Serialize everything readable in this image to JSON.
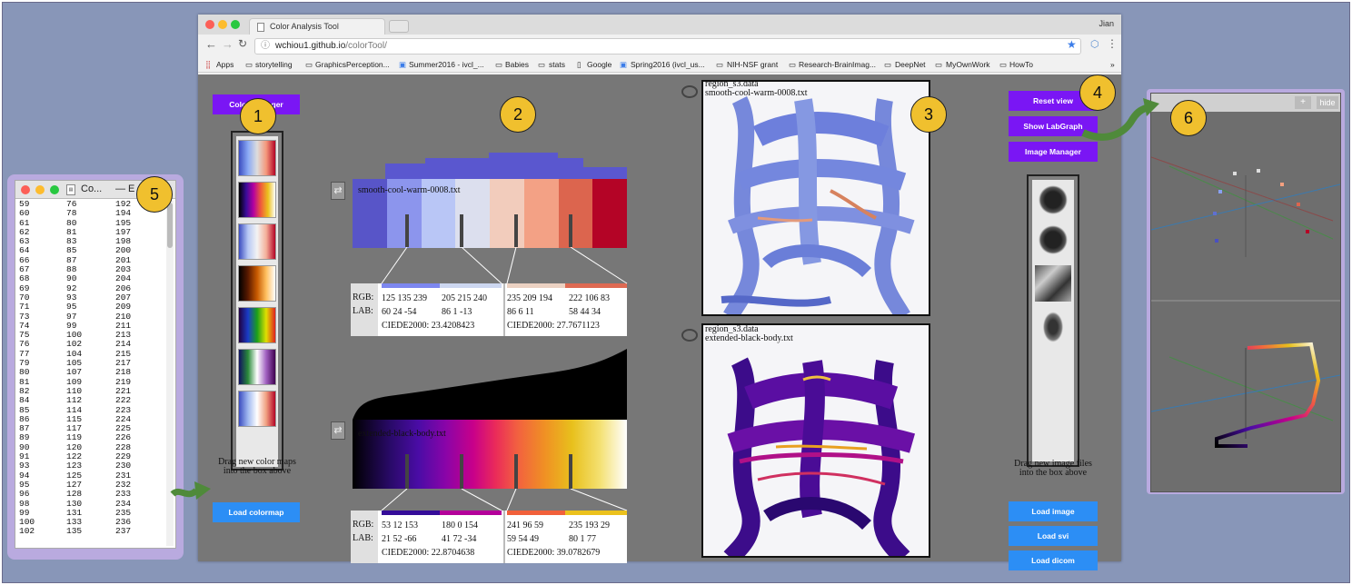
{
  "browser": {
    "tab_title": "Color Analysis Tool",
    "user": "Jian",
    "url_host": "wchiou1.github.io",
    "url_path": "/colorTool/",
    "bookmarks": [
      "Apps",
      "storytelling",
      "GraphicsPerception...",
      "Summer2016 - ivcl_...",
      "Babies",
      "stats",
      "Google",
      "Spring2016 (ivcl_us...",
      "NIH-NSF grant",
      "Research-BrainImag...",
      "DeepNet",
      "MyOwnWork",
      "HowTo"
    ],
    "more": "»"
  },
  "callouts": [
    "1",
    "2",
    "3",
    "4",
    "5",
    "6"
  ],
  "left_panel": {
    "color_manager": "Color Manager",
    "drag_hint_1": "Drag new color maps",
    "drag_hint_2": "into the box above",
    "load_colormap": "Load colormap"
  },
  "colormap1": {
    "name": "smooth-cool-warm-0008.txt",
    "colors": [
      "#5855c8",
      "#8c95ed",
      "#b9c6f6",
      "#dcdfee",
      "#f2ccbc",
      "#f3a185",
      "#dc654e",
      "#b40426"
    ],
    "rgb_label": "RGB:",
    "lab_label": "LAB:",
    "left": {
      "rgb_a": "125 135 239",
      "rgb_b": "205 215 240",
      "lab_a": "60 24 -54",
      "lab_b": "86 1 -13",
      "ciede": "CIEDE2000: 23.4208423",
      "color_a": "#7d87ef",
      "color_b": "#cdd7f0"
    },
    "right": {
      "rgb_a": "235 209 194",
      "rgb_b": "222 106 83",
      "lab_a": "86 6 11",
      "lab_b": "58 44 34",
      "ciede": "CIEDE2000: 27.7671123",
      "color_a": "#ebd1c2",
      "color_b": "#de6a53"
    }
  },
  "colormap2": {
    "name": "extended-black-body.txt",
    "rgb_label": "RGB:",
    "lab_label": "LAB:",
    "left": {
      "rgb_a": "53 12 153",
      "rgb_b": "180 0 154",
      "lab_a": "21 52 -66",
      "lab_b": "41 72 -34",
      "ciede": "CIEDE2000: 22.8704638",
      "color_a": "#350c99",
      "color_b": "#b4009a"
    },
    "right": {
      "rgb_a": "241 96 59",
      "rgb_b": "235 193 29",
      "lab_a": "59 54 49",
      "lab_b": "80 1 77",
      "ciede": "CIEDE2000: 39.0782679",
      "color_a": "#f1603b",
      "color_b": "#ebc11d"
    }
  },
  "views": {
    "top_data": "region_s3.data",
    "top_cmap": "smooth-cool-warm-0008.txt",
    "bottom_data": "region_s3.data",
    "bottom_cmap": "extended-black-body.txt"
  },
  "right_panel": {
    "reset_view": "Reset view",
    "show_labgraph": "Show LabGraph",
    "image_manager": "Image Manager",
    "drag_hint_1": "Drag new image files",
    "drag_hint_2": "into the box above",
    "load_image": "Load image",
    "load_svi": "Load svi",
    "load_dicom": "Load dicom"
  },
  "lab_window": {
    "plus": "+",
    "hide": "hide"
  },
  "file_window": {
    "title": "Co...",
    "title_suffix": "— E",
    "rows": [
      [
        "59",
        "76",
        "192"
      ],
      [
        "60",
        "78",
        "194"
      ],
      [
        "61",
        "80",
        "195"
      ],
      [
        "62",
        "81",
        "197"
      ],
      [
        "63",
        "83",
        "198"
      ],
      [
        "64",
        "85",
        "200"
      ],
      [
        "66",
        "87",
        "201"
      ],
      [
        "67",
        "88",
        "203"
      ],
      [
        "68",
        "90",
        "204"
      ],
      [
        "69",
        "92",
        "206"
      ],
      [
        "70",
        "93",
        "207"
      ],
      [
        "71",
        "95",
        "209"
      ],
      [
        "73",
        "97",
        "210"
      ],
      [
        "74",
        "99",
        "211"
      ],
      [
        "75",
        "100",
        "213"
      ],
      [
        "76",
        "102",
        "214"
      ],
      [
        "77",
        "104",
        "215"
      ],
      [
        "79",
        "105",
        "217"
      ],
      [
        "80",
        "107",
        "218"
      ],
      [
        "81",
        "109",
        "219"
      ],
      [
        "82",
        "110",
        "221"
      ],
      [
        "84",
        "112",
        "222"
      ],
      [
        "85",
        "114",
        "223"
      ],
      [
        "86",
        "115",
        "224"
      ],
      [
        "87",
        "117",
        "225"
      ],
      [
        "89",
        "119",
        "226"
      ],
      [
        "90",
        "120",
        "228"
      ],
      [
        "91",
        "122",
        "229"
      ],
      [
        "93",
        "123",
        "230"
      ],
      [
        "94",
        "125",
        "231"
      ],
      [
        "95",
        "127",
        "232"
      ],
      [
        "96",
        "128",
        "233"
      ],
      [
        "98",
        "130",
        "234"
      ],
      [
        "99",
        "131",
        "235"
      ],
      [
        "100",
        "133",
        "236"
      ],
      [
        "102",
        "135",
        "237"
      ]
    ]
  }
}
